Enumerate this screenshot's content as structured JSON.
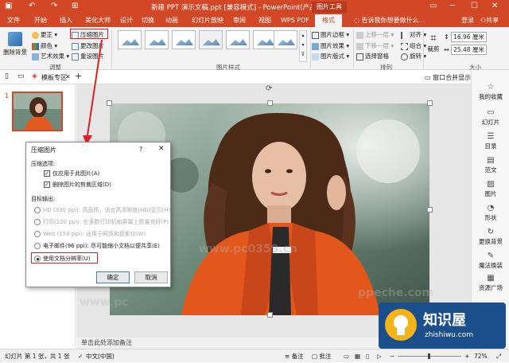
{
  "titlebar": {
    "save_icon": "save-icon",
    "undo_icon": "undo-icon",
    "redo_icon": "redo-icon",
    "title": "新建 PPT 演示文稿.ppt [兼容模式] - PowerPoint(产品激活失败)",
    "tools_tag": "图片工具",
    "min_icon": "minimize-icon",
    "max_icon": "maximize-icon",
    "close_icon": "close-icon"
  },
  "tabs": [
    "文件",
    "开始",
    "插入",
    "美化大师",
    "设计",
    "切换",
    "动画",
    "幻灯片放映",
    "审阅",
    "视图",
    "WPS PDF",
    "格式"
  ],
  "active_tab": "格式",
  "tellme": "告诉我你想要做什么...",
  "login": "登录",
  "share": "共享",
  "ribbon": {
    "remove_bg": "删除背景",
    "corrections": "更正",
    "color": "颜色",
    "artistic": "艺术效果",
    "compress": "压缩图片",
    "change": "更改图片",
    "reset": "重设图片",
    "group_adjust": "调整",
    "group_styles": "图片样式",
    "border": "图片边框",
    "effects": "图片效果",
    "layout": "图片版式",
    "bring_forward": "上移一层",
    "send_backward": "下移一层",
    "selection_pane": "选择窗格",
    "align": "对齐",
    "group": "组合",
    "rotate": "旋转",
    "group_arrange": "排列",
    "crop": "裁剪",
    "height": "16.96 厘米",
    "width": "25.48 厘米",
    "group_size": "大小"
  },
  "doc_tabs": {
    "template": "模板专区",
    "window_merge": "窗口合并显示"
  },
  "slide_number": "1",
  "right_pane": [
    "我的收藏",
    "幻灯片",
    "目录",
    "范文",
    "图片",
    "形状",
    "更换背景",
    "魔法换装",
    "资源广场"
  ],
  "notes_placeholder": "单击此处添加备注",
  "status": {
    "slide_info": "幻灯片 第 1 张，共 1 张",
    "language": "中文(中国)",
    "notes": "备注",
    "comments": "批注",
    "zoom": "72%"
  },
  "dialog": {
    "title": "压缩图片",
    "help": "?",
    "section_options": "压缩选项:",
    "opt_apply_only": "仅应用于此图片(A)",
    "opt_delete_cropped": "删除图片的剪裁区域(D)",
    "section_target": "目标输出:",
    "res_hd": "HD (330 ppi): 高品质，适合高清晰度(HD)显示(H)",
    "res_print": "打印(220 ppi): 在多数打印机和屏幕上质量良好(P)",
    "res_web": "Web (150 ppi): 适用于网页和投影仪(W)",
    "res_email": "电子邮件(96 ppi): 尽可能缩小文档以便共享(E)",
    "res_document": "使用文档分辨率(U)",
    "ok": "确定",
    "cancel": "取消"
  },
  "watermark": {
    "text1": "www.pc",
    "text2": "www.pc0359.cn",
    "text3": "ppeche.com"
  },
  "logo": {
    "name": "知识屋",
    "url": "zhishiwu.com"
  }
}
